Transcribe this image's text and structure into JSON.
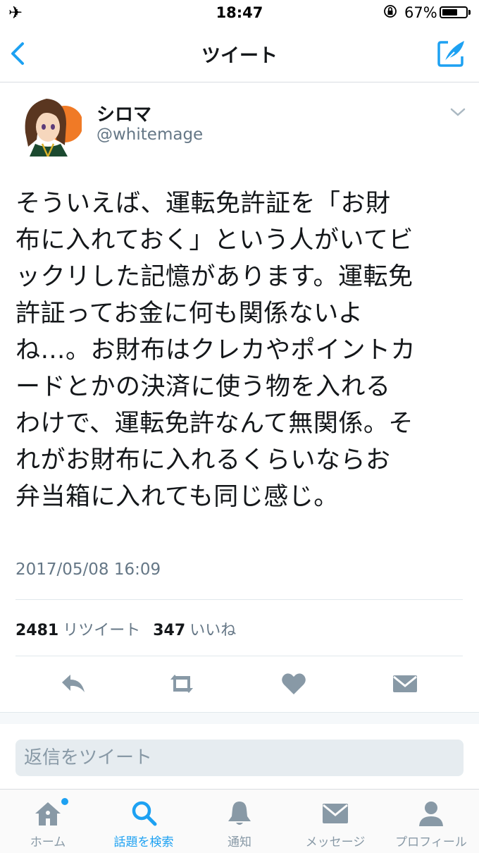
{
  "status_bar": {
    "time": "18:47",
    "battery_text": "67%",
    "battery_level": 0.67,
    "icons": [
      "airplane-icon",
      "orientation-lock-icon",
      "battery-icon"
    ]
  },
  "nav": {
    "title": "ツイート",
    "back_icon": "chevron-left-icon",
    "compose_icon": "compose-tweet-icon",
    "accent_color": "#1da1f2"
  },
  "tweet": {
    "display_name": "シロマ",
    "username": "@whitemage",
    "text_lines": [
      "そういえば、運転免許証を「お財",
      "布に入れておく」という人がいてビ",
      "ックリした記憶があります。運転免",
      "許証ってお金に何も関係ないよ",
      "ね…。お財布はクレカやポイントカ",
      "ードとかの決済に使う物を入れる",
      "わけで、運転免許なんて無関係。そ",
      "れがお財布に入れるくらいならお",
      "弁当箱に入れても同じ感じ。"
    ],
    "timestamp": "2017/05/08 16:09",
    "retweet_count": "2481",
    "retweet_label": "リツイート",
    "like_count": "347",
    "like_label": "いいね"
  },
  "actions": [
    "reply-icon",
    "retweet-icon",
    "like-icon",
    "direct-message-icon"
  ],
  "reply": {
    "placeholder": "返信をツイート"
  },
  "tabbar": {
    "tabs": [
      {
        "label": "ホーム",
        "icon": "home-icon",
        "active": false,
        "badge": true
      },
      {
        "label": "話題を検索",
        "icon": "search-icon",
        "active": true
      },
      {
        "label": "通知",
        "icon": "bell-icon",
        "active": false
      },
      {
        "label": "メッセージ",
        "icon": "envelope-icon",
        "active": false
      },
      {
        "label": "プロフィール",
        "icon": "person-icon",
        "active": false
      }
    ]
  },
  "colors": {
    "text": "#14171a",
    "secondary": "#657786",
    "icon_gray": "#8899a6",
    "accent": "#1da1f2"
  }
}
